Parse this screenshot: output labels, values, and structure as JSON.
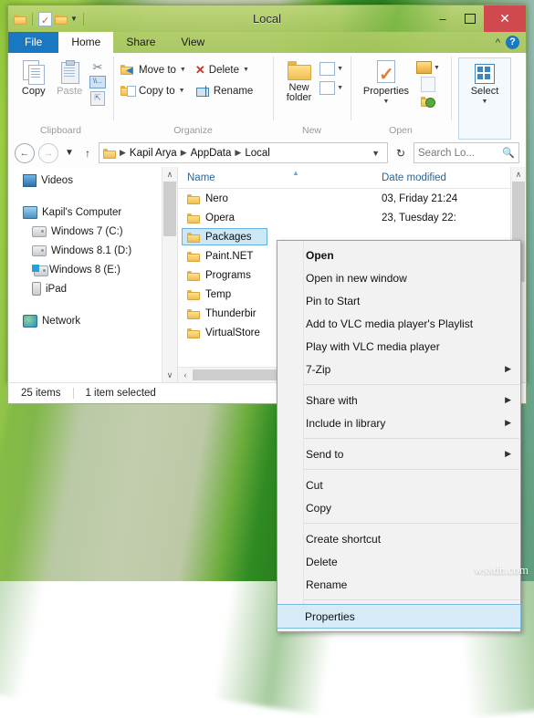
{
  "window": {
    "title": "Local",
    "quick_access": [
      "folder-icon",
      "properties-icon",
      "new-folder-icon",
      "dropdown-icon"
    ],
    "controls": {
      "minimize": "–",
      "maximize": "❐",
      "close": "✕"
    }
  },
  "tabs": [
    {
      "label": "File",
      "state": "file"
    },
    {
      "label": "Home",
      "state": "active"
    },
    {
      "label": "Share",
      "state": "normal"
    },
    {
      "label": "View",
      "state": "normal"
    }
  ],
  "ribbon": {
    "collapse_label": "^",
    "help_label": "?",
    "groups": [
      {
        "name": "Clipboard",
        "label": "Clipboard",
        "big_buttons": [
          {
            "label": "Copy",
            "icon": "copy-icon",
            "enabled": true
          },
          {
            "label": "Paste",
            "icon": "paste-icon",
            "enabled": false
          }
        ],
        "small_icons": [
          "cut-icon",
          "copy-path-icon",
          "paste-shortcut-icon"
        ]
      },
      {
        "name": "Organize",
        "label": "Organize",
        "items": [
          {
            "label": "Move to",
            "icon": "move-to-icon",
            "has_caret": true
          },
          {
            "label": "Copy to",
            "icon": "copy-to-icon",
            "has_caret": true
          },
          {
            "label": "Delete",
            "icon": "delete-icon",
            "has_caret": true
          },
          {
            "label": "Rename",
            "icon": "rename-icon",
            "has_caret": false
          }
        ]
      },
      {
        "name": "New",
        "label": "New",
        "big_buttons": [
          {
            "label": "New folder",
            "icon": "new-folder-icon",
            "enabled": true
          }
        ],
        "small_icons": [
          "new-item-icon",
          "easy-access-icon"
        ]
      },
      {
        "name": "Open",
        "label": "Open",
        "big_buttons": [
          {
            "label": "Properties",
            "icon": "properties-icon",
            "enabled": true
          }
        ],
        "small_icons": [
          "open-icon",
          "edit-icon",
          "history-icon"
        ]
      },
      {
        "name": "Select",
        "label": "",
        "big_buttons": [
          {
            "label": "Select",
            "icon": "select-icon",
            "enabled": true
          }
        ]
      }
    ]
  },
  "address_bar": {
    "back": "back-icon",
    "forward": "forward-icon",
    "recent": "recent-locations-icon",
    "up": "up-icon",
    "breadcrumbs": [
      "Kapil Arya",
      "AppData",
      "Local"
    ],
    "dropdown": "chevron-down-icon",
    "refresh": "refresh-icon",
    "search_placeholder": "Search Lo...",
    "search_icon": "search-icon"
  },
  "nav_pane": {
    "items": [
      {
        "label": "Videos",
        "icon": "videos-icon",
        "indent": false
      },
      {
        "label": "Kapil's Computer",
        "icon": "computer-icon",
        "indent": false
      },
      {
        "label": "Windows 7 (C:)",
        "icon": "drive-icon",
        "indent": true
      },
      {
        "label": "Windows 8.1 (D:)",
        "icon": "drive-icon",
        "indent": true
      },
      {
        "label": "Windows 8 (E:)",
        "icon": "windows-drive-icon",
        "indent": true
      },
      {
        "label": "iPad",
        "icon": "ipad-icon",
        "indent": true
      },
      {
        "label": "Network",
        "icon": "network-icon",
        "indent": false
      }
    ]
  },
  "file_pane": {
    "columns": [
      "Name",
      "Date modified"
    ],
    "rows": [
      {
        "name": "Nero",
        "date": "03, Friday 21:24",
        "selected": false
      },
      {
        "name": "Opera",
        "date": "23, Tuesday 22:",
        "selected": false
      },
      {
        "name": "Packages",
        "date": "",
        "selected": true
      },
      {
        "name": "Paint.NET",
        "date": "",
        "selected": false
      },
      {
        "name": "Programs",
        "date": "",
        "selected": false
      },
      {
        "name": "Temp",
        "date": "",
        "selected": false
      },
      {
        "name": "Thunderbir",
        "date": "",
        "selected": false
      },
      {
        "name": "VirtualStore",
        "date": "",
        "selected": false
      }
    ]
  },
  "status_bar": {
    "item_count": "25 items",
    "selection": "1 item selected"
  },
  "context_menu": {
    "items": [
      {
        "label": "Open",
        "bold": true,
        "submenu": false,
        "highlighted": false
      },
      {
        "label": "Open in new window",
        "bold": false,
        "submenu": false,
        "highlighted": false
      },
      {
        "label": "Pin to Start",
        "bold": false,
        "submenu": false,
        "highlighted": false
      },
      {
        "label": "Add to VLC media player's Playlist",
        "bold": false,
        "submenu": false,
        "highlighted": false
      },
      {
        "label": "Play with VLC media player",
        "bold": false,
        "submenu": false,
        "highlighted": false
      },
      {
        "label": "7-Zip",
        "bold": false,
        "submenu": true,
        "highlighted": false
      },
      {
        "divider": true
      },
      {
        "label": "Share with",
        "bold": false,
        "submenu": true,
        "highlighted": false
      },
      {
        "label": "Include in library",
        "bold": false,
        "submenu": true,
        "highlighted": false
      },
      {
        "divider": true
      },
      {
        "label": "Send to",
        "bold": false,
        "submenu": true,
        "highlighted": false
      },
      {
        "divider": true
      },
      {
        "label": "Cut",
        "bold": false,
        "submenu": false,
        "highlighted": false
      },
      {
        "label": "Copy",
        "bold": false,
        "submenu": false,
        "highlighted": false
      },
      {
        "divider": true
      },
      {
        "label": "Create shortcut",
        "bold": false,
        "submenu": false,
        "highlighted": false
      },
      {
        "label": "Delete",
        "bold": false,
        "submenu": false,
        "highlighted": false
      },
      {
        "label": "Rename",
        "bold": false,
        "submenu": false,
        "highlighted": false
      },
      {
        "divider": true
      },
      {
        "label": "Properties",
        "bold": false,
        "submenu": false,
        "highlighted": true
      }
    ]
  },
  "watermark": {
    "text": "wsxdn.com"
  },
  "colors": {
    "title_green": "#a8c860",
    "file_tab_blue": "#1a78c2",
    "close_red": "#d0494f",
    "selection_blue": "#cce8f7",
    "header_text_blue": "#2a6496"
  }
}
